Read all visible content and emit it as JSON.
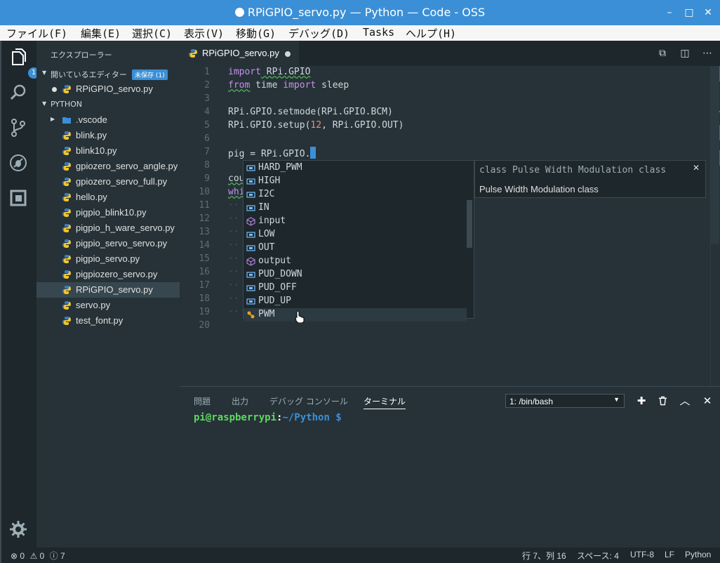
{
  "window": {
    "title": "RPiGPIO_servo.py — Python — Code - OSS"
  },
  "menu": [
    "ファイル(F)",
    "編集(E)",
    "選択(C)",
    "表示(V)",
    "移動(G)",
    "デバッグ(D)",
    "Tasks",
    "ヘルプ(H)"
  ],
  "activity": {
    "explorer_badge": "1"
  },
  "sidebar": {
    "header": "エクスプローラー",
    "open_editors": {
      "label": "開いているエディター",
      "badge": "未保存 (1)",
      "files": [
        "RPiGPIO_servo.py"
      ]
    },
    "folder": {
      "label": "PYTHON",
      "subfolder": ".vscode",
      "files": [
        "blink.py",
        "blink10.py",
        "gpiozero_servo_angle.py",
        "gpiozero_servo_full.py",
        "hello.py",
        "pigpio_blink10.py",
        "pigpio_h_ware_servo.py",
        "pigpio_servo_servo.py",
        "pigpio_servo.py",
        "pigpiozero_servo.py",
        "RPiGPIO_servo.py",
        "servo.py",
        "test_font.py"
      ],
      "selected": "RPiGPIO_servo.py"
    }
  },
  "tab": {
    "label": "RPiGPIO_servo.py"
  },
  "editor": {
    "line_numbers": [
      "1",
      "2",
      "3",
      "4",
      "5",
      "6",
      "7",
      "8",
      "9",
      "10",
      "11",
      "12",
      "13",
      "14",
      "15",
      "16",
      "17",
      "18",
      "19",
      "20"
    ],
    "line1": {
      "kw": "import",
      "rest": " RPi.GPIO"
    },
    "line2": {
      "kw1": "from",
      "mid": " time ",
      "kw2": "import",
      "rest": " sleep"
    },
    "line4": "RPi.GPIO.setmode(RPi.GPIO.BCM)",
    "line5": {
      "pre": "RPi.GPIO.setup(",
      "num": "12",
      "post": ", RPi.GPIO.OUT)"
    },
    "line7": "pig = RPi.GPIO.",
    "line9": "cou",
    "line10": "whi"
  },
  "suggest": {
    "items": [
      {
        "label": "HARD_PWM",
        "kind": "variable"
      },
      {
        "label": "HIGH",
        "kind": "variable"
      },
      {
        "label": "I2C",
        "kind": "variable"
      },
      {
        "label": "IN",
        "kind": "variable"
      },
      {
        "label": "input",
        "kind": "function"
      },
      {
        "label": "LOW",
        "kind": "variable"
      },
      {
        "label": "OUT",
        "kind": "variable"
      },
      {
        "label": "output",
        "kind": "function"
      },
      {
        "label": "PUD_DOWN",
        "kind": "variable"
      },
      {
        "label": "PUD_OFF",
        "kind": "variable"
      },
      {
        "label": "PUD_UP",
        "kind": "variable"
      },
      {
        "label": "PWM",
        "kind": "class"
      }
    ],
    "selected": "PWM",
    "doc_header": "class Pulse Width Modulation class",
    "doc_body": "Pulse Width Modulation class"
  },
  "panel": {
    "tabs": [
      "問題",
      "出力",
      "デバッグ コンソール",
      "ターミナル"
    ],
    "active_tab": "ターミナル",
    "terminal_select": "1: /bin/bash",
    "prompt_user": "pi@raspberrypi",
    "prompt_sep": ":",
    "prompt_path": "~/Python $"
  },
  "status": {
    "errors": "0",
    "warnings": "0",
    "info": "7",
    "position": "行 7、列 16",
    "spaces": "スペース: 4",
    "encoding": "UTF-8",
    "eol": "LF",
    "language": "Python"
  },
  "colors": {
    "accent": "#3b8fd6",
    "background": "#263238",
    "keyword": "#c792ea",
    "number": "#f78c6c"
  }
}
